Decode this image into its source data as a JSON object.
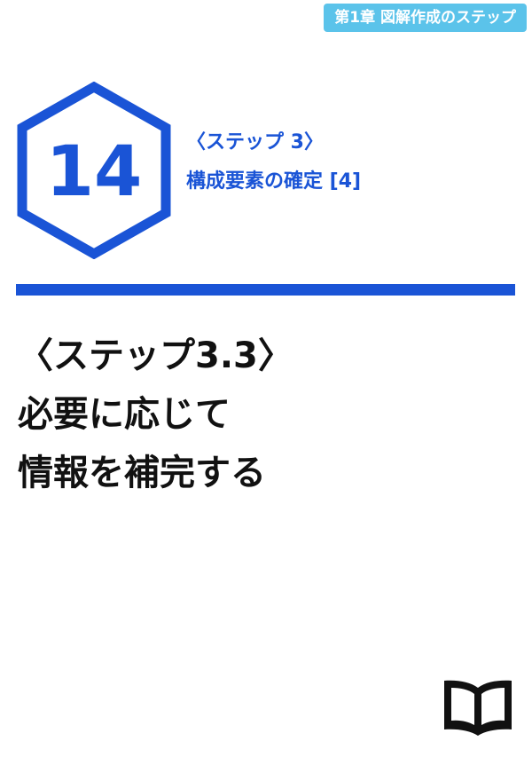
{
  "chapter_tag": "第1章 図解作成のステップ",
  "badge": {
    "number": "14",
    "color": "#1a54d6"
  },
  "section": {
    "step": "〈ステップ 3〉",
    "name": "構成要素の確定 [4]"
  },
  "title": {
    "line1": "〈ステップ3.3〉",
    "line2": "必要に応じて",
    "line3": "情報を補完する"
  },
  "colors": {
    "accent": "#1a54d6",
    "tag_background": "#5bc3ea",
    "text": "#111111"
  },
  "icons": {
    "footer": "open-book-icon"
  }
}
